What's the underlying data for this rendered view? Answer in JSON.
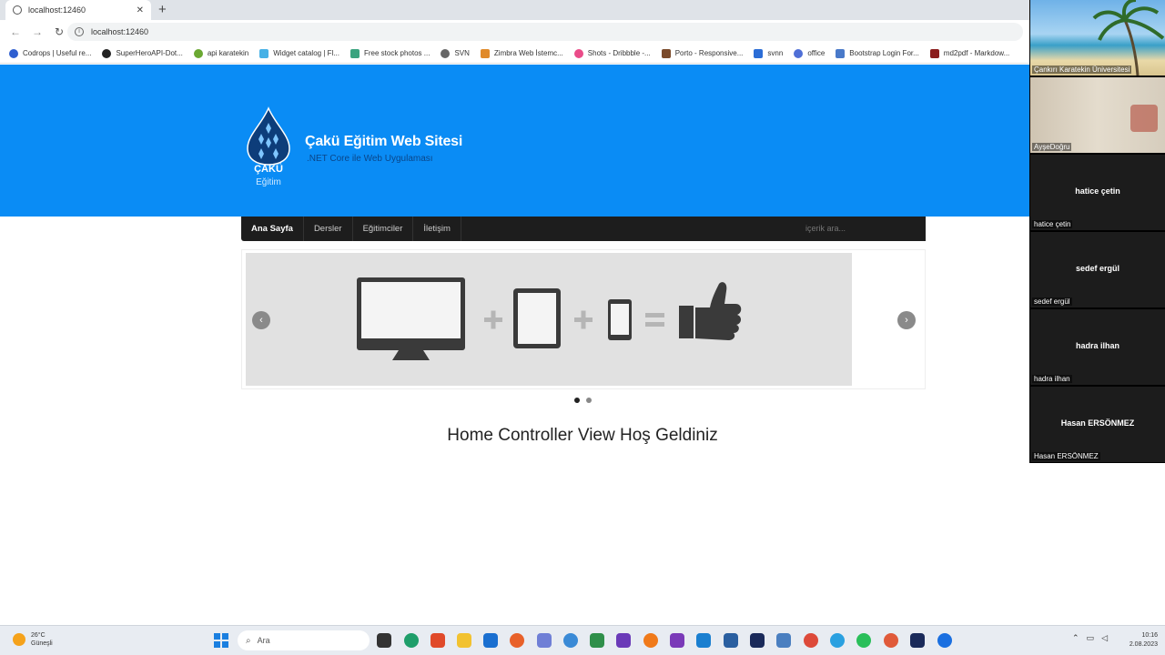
{
  "browser": {
    "tab_title": "localhost:12460",
    "url": "localhost:12460",
    "bookmarks": [
      "Codrops | Useful re...",
      "SuperHeroAPI-Dot...",
      "api karatekin",
      "Widget catalog | Fl...",
      "Free stock photos ...",
      "SVN",
      "Zimbra Web İstemc...",
      "Shots - Dribbble -...",
      "Porto - Responsive...",
      "svnn",
      "office",
      "Bootstrap Login For...",
      "md2pdf - Markdow..."
    ]
  },
  "site": {
    "logo_text_1": "ÇAKÜ",
    "logo_text_2": "Eğitim",
    "title": "Çakü Eğitim Web Sitesi",
    "subtitle": ".NET Core ile Web Uygulaması",
    "menu": [
      "Ana Sayfa",
      "Dersler",
      "Eğitimciler",
      "İletişim"
    ],
    "search_placeholder": "içerik ara...",
    "slider": {
      "prev": "‹",
      "next": "›",
      "active_dot": 0,
      "dot_count": 2
    },
    "welcome": "Home Controller View Hoş Geldiniz"
  },
  "video_panel": {
    "participants": [
      {
        "name": "Çankırı Karatekin Üniversitesi",
        "label": ""
      },
      {
        "name": "AyşeDoğru",
        "label": ""
      },
      {
        "name": "hatice çetin",
        "label": "hatice çetin"
      },
      {
        "name": "sedef ergül",
        "label": "sedef ergül"
      },
      {
        "name": "hadra ilhan",
        "label": "hadra ilhan"
      },
      {
        "name": "Hasan ERSÖNMEZ",
        "label": "Hasan ERSÖNMEZ"
      }
    ]
  },
  "taskbar": {
    "weather_temp": "26°C",
    "weather_desc": "Güneşli",
    "search_label": "Ara",
    "time": "10:16",
    "date": "2.08.2023"
  },
  "colors": {
    "hero_blue": "#0a8cf5",
    "menu_dark": "#1d1d1d",
    "taskbar": "#e8ecf2"
  }
}
